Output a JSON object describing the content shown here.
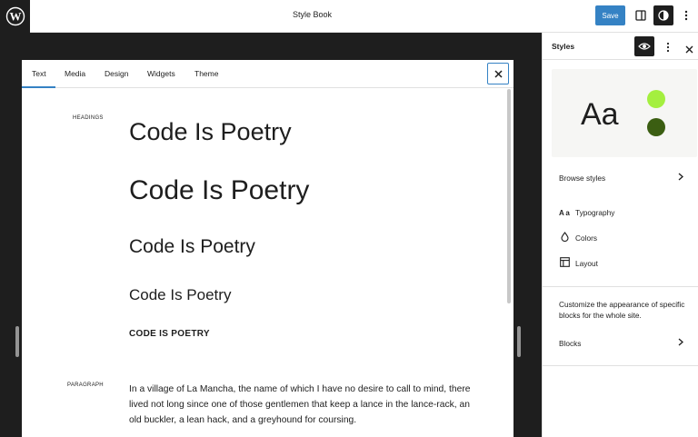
{
  "topbar": {
    "logo_icon": "wordpress-icon",
    "title": "Style Book",
    "save_label": "Save",
    "icons": [
      "sidebar-toggle-icon",
      "styles-contrast-icon",
      "more-vertical-icon"
    ]
  },
  "book": {
    "tabs": [
      {
        "label": "Text"
      },
      {
        "label": "Media"
      },
      {
        "label": "Design"
      },
      {
        "label": "Widgets"
      },
      {
        "label": "Theme"
      }
    ],
    "active_tab": "Text",
    "close_icon": "close-icon",
    "headings_label": "HEADINGS",
    "headings": [
      "Code Is Poetry",
      "Code Is Poetry",
      "Code Is Poetry",
      "Code Is Poetry",
      "CODE IS POETRY"
    ],
    "paragraph_label": "PARAGRAPH",
    "paragraph": "In a village of La Mancha, the name of which I have no desire to call to mind, there lived not long since one of those gentlemen that keep a lance in the lance-rack, an old buckler, a lean hack, and a greyhound for coursing."
  },
  "sidebar": {
    "title": "Styles",
    "header_icons": [
      "eye-icon",
      "more-vertical-icon",
      "close-icon"
    ],
    "preview": {
      "text": "Aa",
      "colors": [
        "#a4ef3f",
        "#3b5e12"
      ]
    },
    "browse_styles": "Browse styles",
    "menu": [
      {
        "icon": "typography-icon",
        "icon_text": "A a",
        "label": "Typography"
      },
      {
        "icon": "colors-droplet-icon",
        "label": "Colors"
      },
      {
        "icon": "layout-icon",
        "label": "Layout"
      }
    ],
    "customize_text": "Customize the appearance of specific blocks for the whole site.",
    "blocks_label": "Blocks"
  },
  "colors": {
    "accent": "#3582c4",
    "dark": "#1e1e1e"
  }
}
